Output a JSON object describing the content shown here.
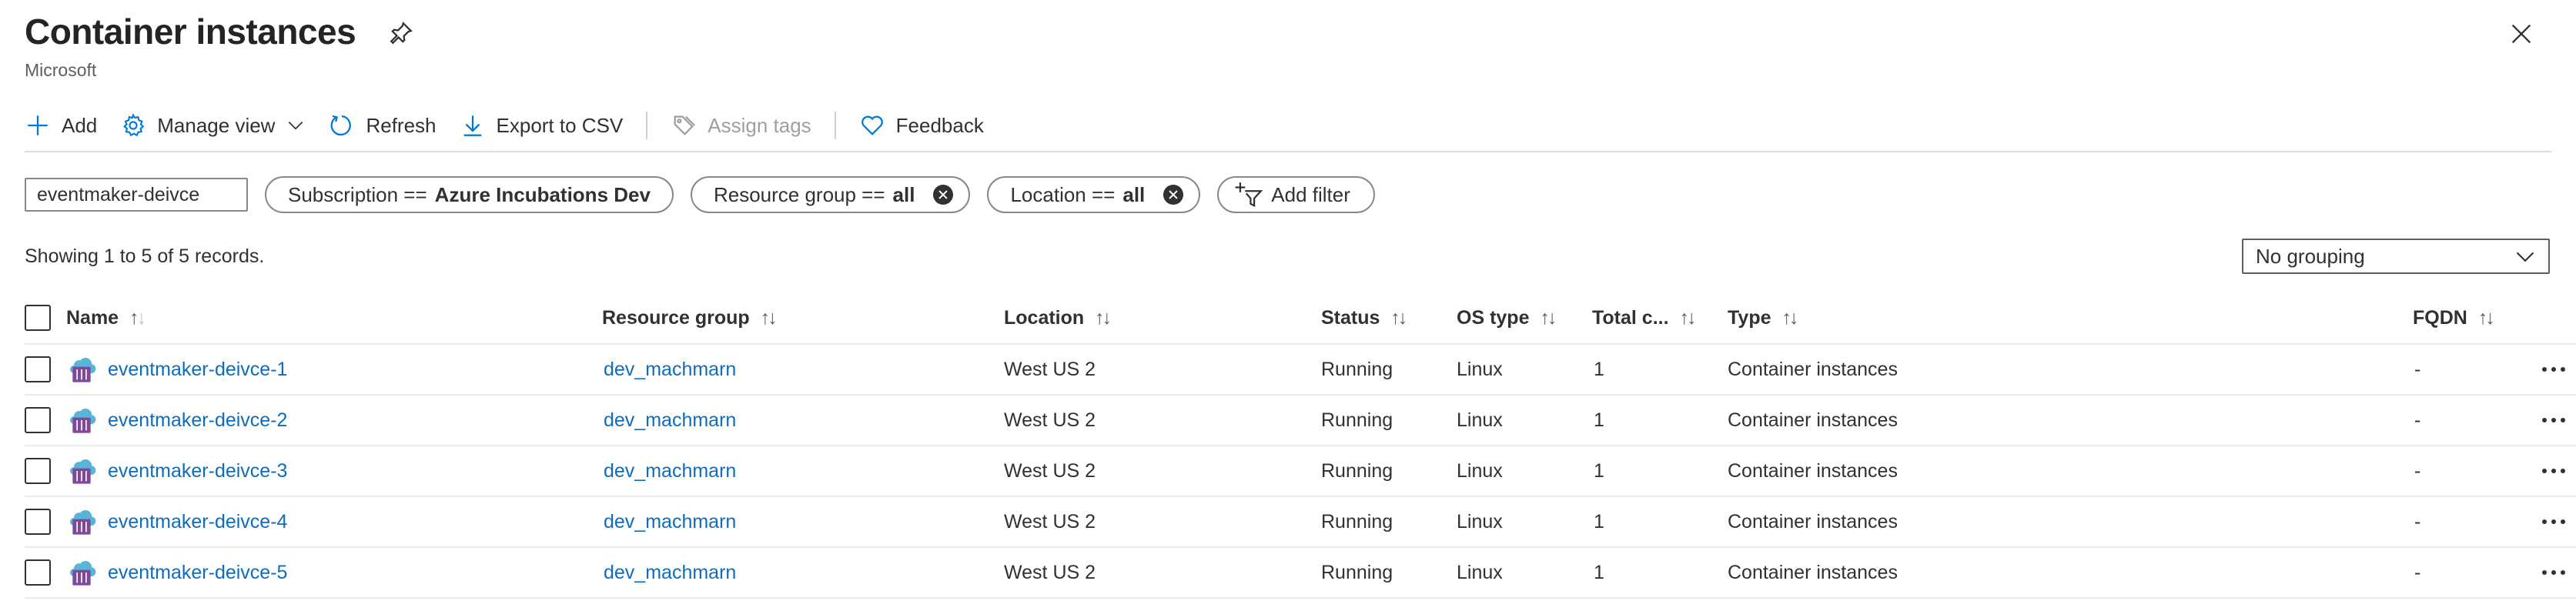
{
  "header": {
    "title": "Container instances",
    "subtitle": "Microsoft"
  },
  "toolbar": {
    "add": "Add",
    "manage_view": "Manage view",
    "refresh": "Refresh",
    "export_csv": "Export to CSV",
    "assign_tags": "Assign tags",
    "feedback": "Feedback"
  },
  "filters": {
    "search_value": "eventmaker-deivce",
    "subscription_label": "Subscription ==",
    "subscription_value": "Azure Incubations Dev",
    "resource_group_label": "Resource group ==",
    "resource_group_value": "all",
    "location_label": "Location ==",
    "location_value": "all",
    "add_filter": "Add filter"
  },
  "records_text": "Showing 1 to 5 of 5 records.",
  "grouping": {
    "selected": "No grouping"
  },
  "table": {
    "columns": {
      "name": "Name",
      "resource_group": "Resource group",
      "location": "Location",
      "status": "Status",
      "os_type": "OS type",
      "total": "Total c...",
      "type": "Type",
      "fqdn": "FQDN"
    },
    "rows": [
      {
        "name": "eventmaker-deivce-1",
        "resource_group": "dev_machmarn",
        "location": "West US 2",
        "status": "Running",
        "os_type": "Linux",
        "total": "1",
        "type": "Container instances",
        "fqdn": "-"
      },
      {
        "name": "eventmaker-deivce-2",
        "resource_group": "dev_machmarn",
        "location": "West US 2",
        "status": "Running",
        "os_type": "Linux",
        "total": "1",
        "type": "Container instances",
        "fqdn": "-"
      },
      {
        "name": "eventmaker-deivce-3",
        "resource_group": "dev_machmarn",
        "location": "West US 2",
        "status": "Running",
        "os_type": "Linux",
        "total": "1",
        "type": "Container instances",
        "fqdn": "-"
      },
      {
        "name": "eventmaker-deivce-4",
        "resource_group": "dev_machmarn",
        "location": "West US 2",
        "status": "Running",
        "os_type": "Linux",
        "total": "1",
        "type": "Container instances",
        "fqdn": "-"
      },
      {
        "name": "eventmaker-deivce-5",
        "resource_group": "dev_machmarn",
        "location": "West US 2",
        "status": "Running",
        "os_type": "Linux",
        "total": "1",
        "type": "Container instances",
        "fqdn": "-"
      }
    ]
  },
  "colors": {
    "link": "#0f6cbd",
    "accent": "#0078d4",
    "text": "#323130",
    "muted": "#a19f9d"
  }
}
